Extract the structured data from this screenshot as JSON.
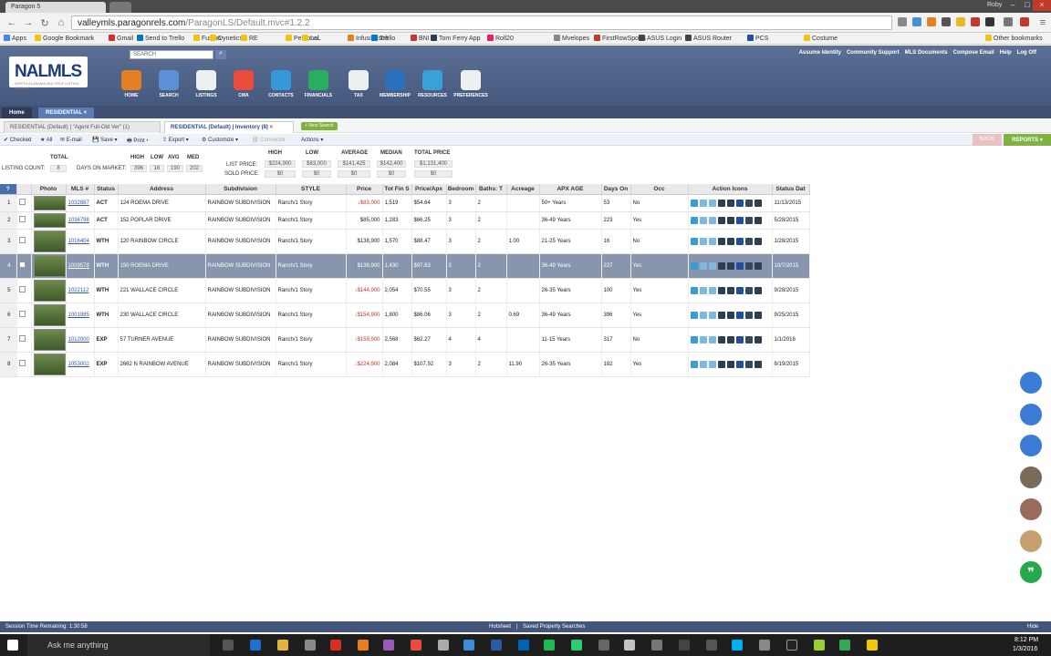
{
  "browser": {
    "tab_title": "Paragon 5",
    "url_host": "valleymls.paragonrels.com",
    "url_path": "/ParagonLS/Default.mvc#1.2.2",
    "user": "Roby"
  },
  "bookmarks": [
    "Apps",
    "Google Bookmark",
    "Gmail",
    "Send to Trello",
    "Fusion",
    "Dynetics",
    "RE",
    "Personal",
    "LoL",
    "Infusionsoft",
    "Trello",
    "BNI",
    "Tom Ferry App",
    "Roll20",
    "Mvelopes",
    "FirstRowSports",
    "ASUS Login",
    "ASUS Router",
    "PCS",
    "Costume",
    "Other bookmarks"
  ],
  "app": {
    "logo": "NALMLS",
    "logo_sub": "NORTH ALABAMA MULTIPLE LISTING SERVICE",
    "search_placeholder": "SEARCH",
    "nav": [
      "HOME",
      "SEARCH",
      "LISTINGS",
      "CMA",
      "CONTACTS",
      "FINANCIALS",
      "TAX",
      "MEMBERSHIP",
      "RESOURCES",
      "PREFERENCES"
    ],
    "top_links": [
      "Assume Identity",
      "Community Support",
      "MLS Documents",
      "Compose Email",
      "Help",
      "Log Off"
    ],
    "subtabs": [
      "Home",
      "RESIDENTIAL"
    ],
    "result_tabs": [
      "RESIDENTIAL (Default) | \"Agent Full-Old Ver\" (1)",
      "RESIDENTIAL (Default) | Inventory (8)"
    ],
    "new_search": "+ New Search",
    "actions": [
      "Checked",
      "All",
      "E-mail",
      "Save",
      "Print",
      "Export",
      "Customize",
      "Connector",
      "Actions"
    ],
    "back": "BACK",
    "reports": "REPORTS"
  },
  "stats": {
    "total_label": "TOTAL",
    "listing_count_label": "LISTING COUNT:",
    "listing_count": "8",
    "dom_label": "DAYS ON MARKET:",
    "high_label": "HIGH",
    "low_label": "LOW",
    "avg_label": "AVG",
    "med_label": "MED",
    "dom": [
      "396",
      "16",
      "190",
      "202"
    ],
    "price_headers": [
      "HIGH",
      "LOW",
      "AVERAGE",
      "MEDIAN",
      "TOTAL PRICE"
    ],
    "list_price_label": "LIST PRICE:",
    "sold_price_label": "SOLD PRICE:",
    "list_prices": [
      "$224,900",
      "$83,000",
      "$141,425",
      "$142,400",
      "$1,131,400"
    ],
    "sold_prices": [
      "$0",
      "$0",
      "$0",
      "$0",
      "$0"
    ]
  },
  "table": {
    "headers": [
      "?",
      "",
      "Photo",
      "MLS #",
      "Status",
      "Address",
      "Subdivision",
      "STYLE",
      "Price",
      "Tot Fin S",
      "Price/Apx",
      "Bedroom",
      "Baths: T",
      "Acreage",
      "APX AGE",
      "Days On",
      "Occ",
      "Action Icons",
      "Status Dat"
    ],
    "rows": [
      {
        "n": "1",
        "mls": "1032887",
        "status": "ACT",
        "address": "124 ROEMA DRIVE",
        "sub": "RAINBOW SUBDIVISION",
        "style": "Ranch/1 Story",
        "price": "$83,000",
        "down": true,
        "sqft": "1,519",
        "ppsf": "$54.64",
        "bed": "3",
        "bath": "2",
        "acre": "",
        "age": "50+ Years",
        "dom": "53",
        "occ": "No",
        "date": "11/13/2015"
      },
      {
        "n": "2",
        "mls": "1036798",
        "status": "ACT",
        "address": "152 POPLAR DRIVE",
        "sub": "RAINBOW SUBDIVISION",
        "style": "Ranch/1 Story",
        "price": "$85,000",
        "down": false,
        "sqft": "1,283",
        "ppsf": "$66.25",
        "bed": "3",
        "bath": "2",
        "acre": "",
        "age": "36-49 Years",
        "dom": "223",
        "occ": "Yes",
        "date": "5/28/2015"
      },
      {
        "n": "3",
        "mls": "1016404",
        "status": "WTH",
        "address": "120 RAINBOW CIRCLE",
        "sub": "RAINBOW SUBDIVISION",
        "style": "Ranch/1 Story",
        "price": "$138,900",
        "down": false,
        "sqft": "1,570",
        "ppsf": "$88.47",
        "bed": "3",
        "bath": "2",
        "acre": "1.00",
        "age": "21-25 Years",
        "dom": "16",
        "occ": "No",
        "date": "1/28/2015"
      },
      {
        "n": "4",
        "mls": "1009578",
        "status": "WTH",
        "address": "150 ROEMA DRIVE",
        "sub": "RAINBOW SUBDIVISION",
        "style": "Ranch/1 Story",
        "price": "$139,900",
        "down": true,
        "sqft": "1,430",
        "ppsf": "$97.83",
        "bed": "3",
        "bath": "2",
        "acre": "",
        "age": "36-49 Years",
        "dom": "227",
        "occ": "Yes",
        "date": "10/7/2015"
      },
      {
        "n": "5",
        "mls": "1022112",
        "status": "WTH",
        "address": "221 WALLACE CIRCLE",
        "sub": "RAINBOW SUBDIVISION",
        "style": "Ranch/1 Story",
        "price": "$144,900",
        "down": true,
        "sqft": "2,054",
        "ppsf": "$70.55",
        "bed": "3",
        "bath": "2",
        "acre": "",
        "age": "26-35 Years",
        "dom": "100",
        "occ": "Yes",
        "date": "9/28/2015"
      },
      {
        "n": "6",
        "mls": "1001985",
        "status": "WTH",
        "address": "230 WALLACE CIRCLE",
        "sub": "RAINBOW SUBDIVISION",
        "style": "Ranch/1 Story",
        "price": "$154,900",
        "down": true,
        "sqft": "1,800",
        "ppsf": "$86.06",
        "bed": "3",
        "bath": "2",
        "acre": "0.69",
        "age": "36-49 Years",
        "dom": "396",
        "occ": "Yes",
        "date": "9/25/2015"
      },
      {
        "n": "7",
        "mls": "1012000",
        "status": "EXP",
        "address": "57 TURNER AVENUE",
        "sub": "RAINBOW SUBDIVISION",
        "style": "Ranch/1 Story",
        "price": "$159,900",
        "down": true,
        "sqft": "2,568",
        "ppsf": "$62.27",
        "bed": "4",
        "bath": "4",
        "acre": "",
        "age": "11-15 Years",
        "dom": "317",
        "occ": "No",
        "date": "1/1/2016"
      },
      {
        "n": "8",
        "mls": "1053002",
        "status": "EXP",
        "address": "2662 N RAINBOW AVENUE",
        "sub": "RAINBOW SUBDIVISION",
        "style": "Ranch/1 Story",
        "price": "$224,900",
        "down": true,
        "sqft": "2,084",
        "ppsf": "$107.92",
        "bed": "3",
        "bath": "2",
        "acre": "11.90",
        "age": "26-35 Years",
        "dom": "182",
        "occ": "Yes",
        "date": "8/19/2015"
      }
    ]
  },
  "status_bar": {
    "session": "Session Time Remaining: 1:30:58",
    "hotsheet": "Hotsheet",
    "saved": "Saved Property Searches",
    "hide": "Hide"
  },
  "taskbar": {
    "ask": "Ask me anything",
    "time": "8:12 PM",
    "date": "1/3/2016"
  }
}
